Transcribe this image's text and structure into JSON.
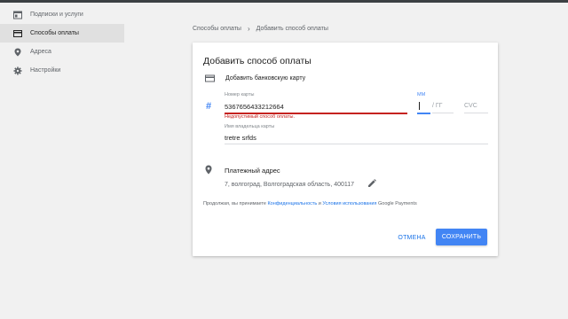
{
  "sidebar": {
    "items": [
      {
        "label": "Подписки и услуги",
        "icon": "subscriptions-icon",
        "active": false
      },
      {
        "label": "Способы оплаты",
        "icon": "credit-card-icon",
        "active": true
      },
      {
        "label": "Адреса",
        "icon": "location-pin-icon",
        "active": false
      },
      {
        "label": "Настройки",
        "icon": "gear-icon",
        "active": false
      }
    ]
  },
  "breadcrumb": {
    "parent": "Способы оплаты",
    "separator": "›",
    "current": "Добавить способ оплаты"
  },
  "dialog": {
    "title": "Добавить способ оплаты",
    "card_row_label": "Добавить банковскую карту",
    "card_number": {
      "label": "Номер карты",
      "value": "5367656433212664",
      "error": "Недопустимый способ оплаты."
    },
    "expiry": {
      "month_label": "ММ",
      "year_placeholder": "/ ГГ"
    },
    "cvc_placeholder": "CVC",
    "cardholder": {
      "label": "Имя владельца карты",
      "value": "tretre srfds"
    },
    "billing": {
      "title": "Платежный адрес",
      "address": "7, волгоград, Волгоградская область, 400117"
    },
    "terms": {
      "prefix": "Продолжая, вы принимаете ",
      "privacy_link": "Конфиденциальность",
      "and": " и ",
      "terms_link": "Условия использования",
      "suffix": " Google Payments"
    },
    "cancel_label": "ОТМЕНА",
    "save_label": "СОХРАНИТЬ"
  },
  "colors": {
    "accent": "#4285f4",
    "error": "#c5221f",
    "link": "#1a73e8",
    "background": "#f1f1f1"
  }
}
